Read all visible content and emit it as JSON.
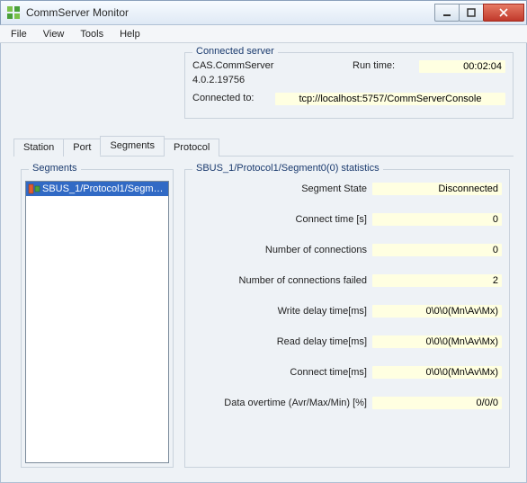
{
  "window": {
    "title": "CommServer Monitor"
  },
  "menu": {
    "file": "File",
    "view": "View",
    "tools": "Tools",
    "help": "Help"
  },
  "connected": {
    "legend": "Connected server",
    "server_name": "CAS.CommServer",
    "version": "4.0.2.19756",
    "runtime_label": "Run time:",
    "runtime_value": "00:02:04",
    "connected_to_label": "Connected to:",
    "connected_to_value": "tcp://localhost:5757/CommServerConsole"
  },
  "tabs": {
    "station": "Station",
    "port": "Port",
    "segments": "Segments",
    "protocol": "Protocol"
  },
  "segments_box": {
    "legend": "Segments",
    "items": [
      {
        "label": "SBUS_1/Protocol1/Segment..."
      }
    ]
  },
  "stats": {
    "legend": "SBUS_1/Protocol1/Segment0(0) statistics",
    "rows": [
      {
        "label": "Segment State",
        "value": "Disconnected"
      },
      {
        "label": "Connect time [s]",
        "value": "0"
      },
      {
        "label": "Number of connections",
        "value": "0"
      },
      {
        "label": "Number of connections failed",
        "value": "2"
      },
      {
        "label": "Write delay time[ms]",
        "value": "0\\0\\0(Mn\\Av\\Mx)"
      },
      {
        "label": "Read delay time[ms]",
        "value": "0\\0\\0(Mn\\Av\\Mx)"
      },
      {
        "label": "Connect time[ms]",
        "value": "0\\0\\0(Mn\\Av\\Mx)"
      },
      {
        "label": "Data overtime (Avr/Max/Min) [%]",
        "value": "0/0/0"
      }
    ]
  }
}
